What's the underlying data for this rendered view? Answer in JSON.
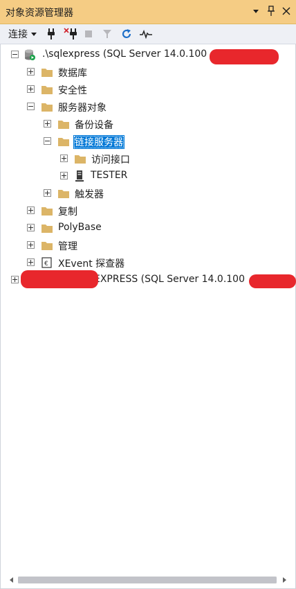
{
  "window": {
    "title": "对象资源管理器"
  },
  "window_controls": {
    "dropdown_icon": "chevron-down-icon",
    "pin_icon": "pin-icon",
    "close_icon": "close-icon"
  },
  "toolbar": {
    "connect_label": "连接",
    "buttons": [
      "connect-plug-icon",
      "disconnect-plug-icon",
      "stop-icon",
      "filter-icon",
      "refresh-icon",
      "activity-monitor-icon"
    ]
  },
  "tree": {
    "server1": {
      "label": ".\\sqlexpress (SQL Server 14.0.100",
      "expanded": true
    },
    "databases": {
      "label": "数据库"
    },
    "security": {
      "label": "安全性"
    },
    "server_objects": {
      "label": "服务器对象"
    },
    "backup_devices": {
      "label": "备份设备"
    },
    "linked_servers": {
      "label": "链接服务器"
    },
    "providers": {
      "label": "访问接口"
    },
    "tester": {
      "label": "TESTER"
    },
    "triggers": {
      "label": "触发器"
    },
    "replication": {
      "label": "复制"
    },
    "polybase": {
      "label": "PolyBase"
    },
    "management": {
      "label": "管理"
    },
    "xevent": {
      "label": "XEvent 探查器"
    },
    "server2": {
      "label": "EXPRESS (SQL Server 14.0.100"
    }
  },
  "colors": {
    "title_bg": "#f5cc84",
    "selection": "#0078d7",
    "folder": "#dcb567",
    "redaction": "#e8272c"
  }
}
